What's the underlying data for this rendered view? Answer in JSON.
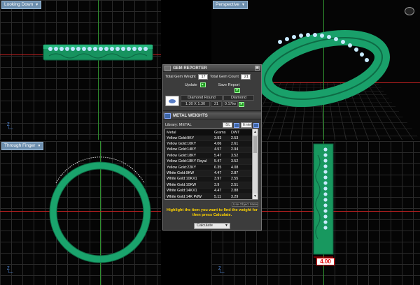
{
  "viewports": {
    "top_left": "Looking Down",
    "top_right": "Perspective",
    "bottom_left": "Through Finger",
    "bottom_right": ""
  },
  "gem_reporter": {
    "title": "GEM REPORTER",
    "total_gem_weight_label": "Total Gem Weight",
    "total_gem_weight": "17",
    "total_gem_count_label": "Total Gem Count",
    "total_gem_count": "21",
    "update_label": "Update",
    "save_report_label": "Save Report",
    "gem_header_left": "Diamond Round",
    "gem_header_right": "Diamond",
    "gem_size": "1.30 X 1.30",
    "gem_count": "21",
    "gem_weight": "0.17tw"
  },
  "metal_weights": {
    "title": "METAL WEIGHTS",
    "library_label": "Library: METAL",
    "options": [
      "ISL",
      "Enter"
    ],
    "columns": [
      "Metal",
      "Grams",
      "DWT"
    ],
    "rows": [
      {
        "metal": "Yellow Gold:9KY",
        "grams": "3.93",
        "dwt": "2.53"
      },
      {
        "metal": "Yellow Gold:10KY",
        "grams": "4.06",
        "dwt": "2.61"
      },
      {
        "metal": "Yellow Gold:14KY",
        "grams": "4.57",
        "dwt": "2.94"
      },
      {
        "metal": "Yellow Gold:18KY",
        "grams": "5.47",
        "dwt": "3.52"
      },
      {
        "metal": "Yellow Gold:18KY Royal",
        "grams": "5.47",
        "dwt": "3.52"
      },
      {
        "metal": "Yellow Gold:22KY",
        "grams": "6.35",
        "dwt": "4.08"
      },
      {
        "metal": "White Gold:9KW",
        "grams": "4.47",
        "dwt": "2.87"
      },
      {
        "metal": "White Gold:10KX1",
        "grams": "3.97",
        "dwt": "2.55"
      },
      {
        "metal": "White Gold:10KW",
        "grams": "3.9",
        "dwt": "2.51"
      },
      {
        "metal": "White Gold:14KX1",
        "grams": "4.47",
        "dwt": "2.88"
      },
      {
        "metal": "White Gold:14K PdW",
        "grams": "5.11",
        "dwt": "3.29"
      }
    ],
    "use_object_materials": "Use Object Materials",
    "hint": "Highlight the item you want to find the weight for then press Calculate.",
    "calculate_label": "Calculate"
  },
  "dimension_label": "4.00",
  "colors": {
    "ring_green": "#1fa774",
    "grid": "#2a2a2a",
    "accent_blue": "#3d67a8",
    "hint_yellow": "#ffd400",
    "dimension_red": "#e00000"
  }
}
